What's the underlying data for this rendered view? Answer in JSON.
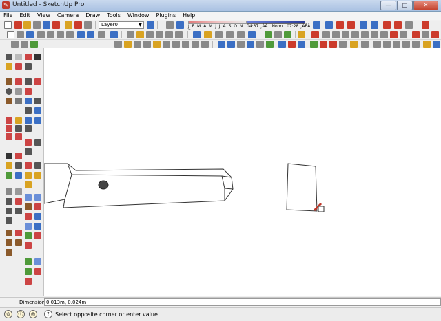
{
  "window": {
    "title": "Untitled - SketchUp Pro",
    "app_icon": "sketchup-icon",
    "buttons": {
      "minimize": "—",
      "maximize": "□",
      "close": "✕"
    }
  },
  "menu": [
    "File",
    "Edit",
    "View",
    "Camera",
    "Draw",
    "Tools",
    "Window",
    "Plugins",
    "Help"
  ],
  "layers": {
    "current": "Layer0"
  },
  "shadows": {
    "months": "J F M A M J J A S O N D",
    "time_start": "04:37 ¸ÀÄ",
    "time_noon": "Noon",
    "time_end": "07:28 ¸ÀÊÄ"
  },
  "measurements": {
    "label": "Dimensions",
    "value": "0.013m, 0.024m"
  },
  "status": {
    "text": "Select opposite corner or enter value."
  },
  "colors": {
    "accent": "#3b6fc4",
    "tool_red": "#cc3b2b",
    "tool_yellow": "#d9a322",
    "tool_green": "#4f9a3a"
  }
}
